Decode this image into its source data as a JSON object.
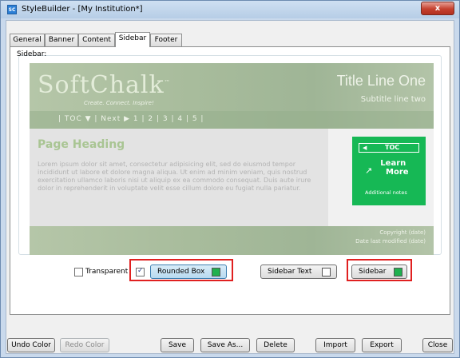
{
  "window": {
    "app_icon": "SC",
    "title": "StyleBuilder - [My Institution*]",
    "close_label": "x"
  },
  "tabs": [
    {
      "label": "General"
    },
    {
      "label": "Banner"
    },
    {
      "label": "Content"
    },
    {
      "label": "Sidebar",
      "active": true
    },
    {
      "label": "Footer"
    }
  ],
  "group": {
    "label": "Sidebar:"
  },
  "preview": {
    "logo": "SoftChalk",
    "logo_tm": "™",
    "tagline": "Create. Connect. Inspire!",
    "title_line": "Title Line One",
    "subtitle_line": "Subtitle line two",
    "nav_text": "| TOC     ▼ | Next ▶   1  |  2  |  3  |  4  |  5  |",
    "page_heading": "Page Heading",
    "lorem": "Lorem ipsum dolor sit amet, consectetur adipisicing elit, sed do eiusmod tempor incididunt ut labore et dolore magna aliqua. Ut enim ad minim veniam, quis nostrud exercitation ullamco laboris nisi ut aliquip ex ea commodo consequat. Duis aute irure dolor in reprehenderit in voluptate velit esse cillum dolore eu fugiat nulla pariatur.",
    "sidebar": {
      "toc_arrow": "◀",
      "toc_label": "TOC",
      "learn_line1": "Learn",
      "learn_line2": "More",
      "pointer_icon": "↗",
      "notes": "Additional notes",
      "color": "#16b855"
    },
    "copyright": "Copyright (date)",
    "last_modified": "Date last modified (date)"
  },
  "options": {
    "transparent_label": "Transparent",
    "transparent_checked": false,
    "rounded_checked": true,
    "rounded_box_label": "Rounded Box",
    "rounded_box_color": "#1fb04f",
    "sidebar_text_label": "Sidebar Text",
    "sidebar_text_color": "#ffffff",
    "sidebar_label": "Sidebar",
    "sidebar_color": "#1fb04f",
    "highlight_color": "#e02020"
  },
  "buttons": {
    "undo_color": "Undo Color",
    "redo_color": "Redo Color",
    "save": "Save",
    "save_as": "Save As...",
    "delete": "Delete",
    "import": "Import",
    "export": "Export",
    "close": "Close"
  }
}
